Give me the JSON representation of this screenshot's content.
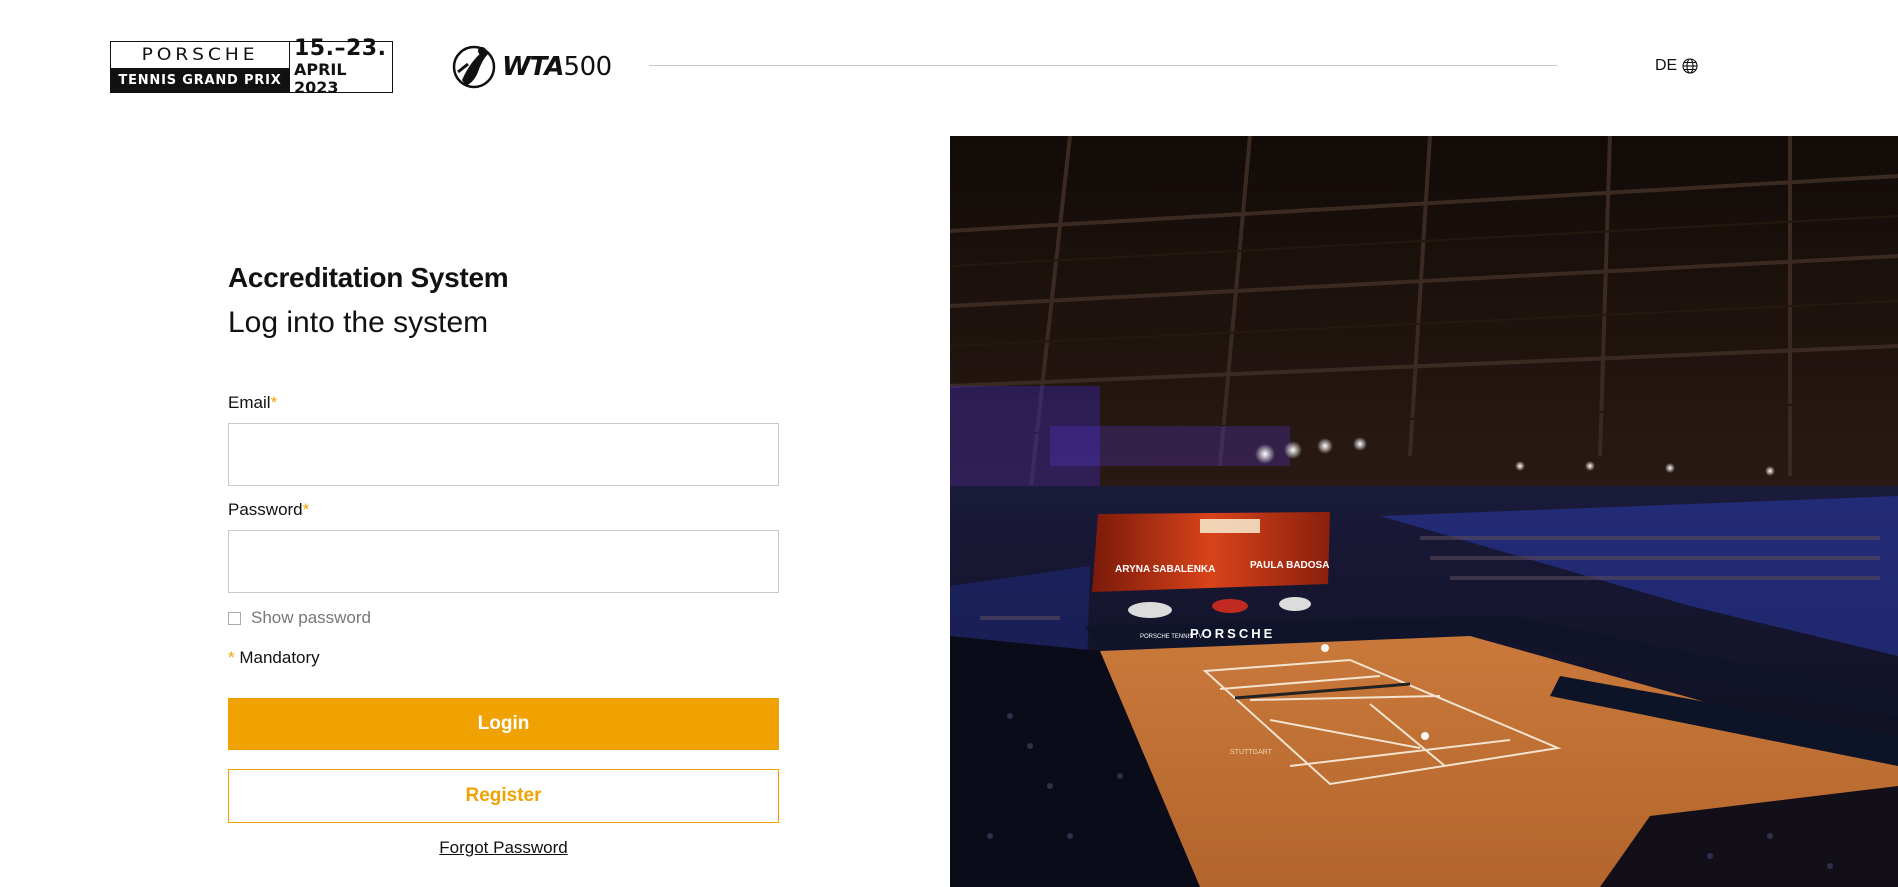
{
  "header": {
    "logo_brand": "PORSCHE",
    "logo_sub": "TENNIS GRAND PRIX",
    "logo_dates": "15.–23.",
    "logo_month": "APRIL 2023",
    "wta_text": "WTA",
    "wta_number": "500",
    "language": "DE"
  },
  "form": {
    "title": "Accreditation System",
    "subtitle": "Log into the system",
    "email_label": "Email",
    "password_label": "Password",
    "required_marker": "*",
    "show_password_label": "Show password",
    "mandatory_label": "Mandatory",
    "login_label": "Login",
    "register_label": "Register",
    "forgot_label": "Forgot Password"
  },
  "hero": {
    "player_left": "ARYNA SABALENKA",
    "player_right": "PAULA BADOSA",
    "board_brand": "PORSCHE",
    "board_tv": "PORSCHE TENNIS TV",
    "court_brand": "STUTTGART"
  },
  "colors": {
    "accent": "#f0a202",
    "clay": "#d4843f",
    "border": "#c9c9c9"
  }
}
